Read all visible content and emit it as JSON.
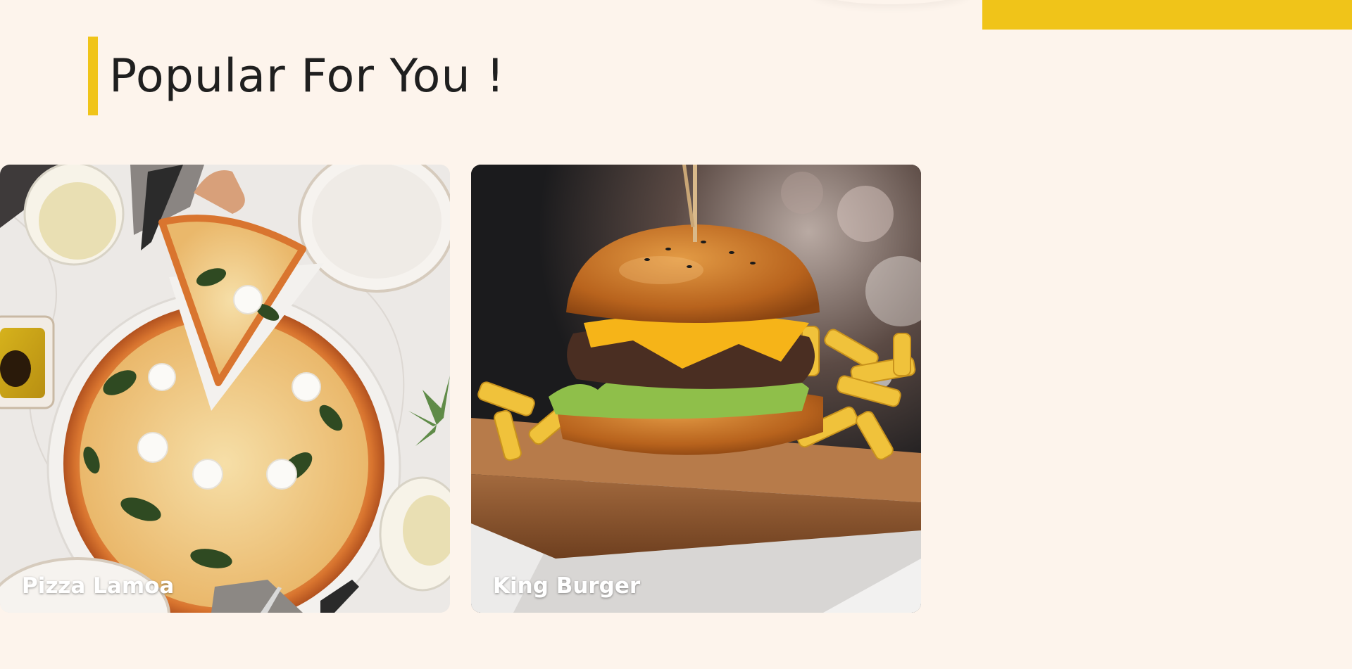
{
  "section": {
    "title": "Popular For You !"
  },
  "cards": [
    {
      "label": "Pizza Lamoa"
    },
    {
      "label": "King Burger"
    }
  ],
  "colors": {
    "background": "#fdf4ec",
    "accent": "#f0c419",
    "heading_text": "#1f1f1f",
    "card_label": "#ffffff"
  }
}
